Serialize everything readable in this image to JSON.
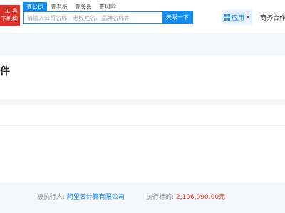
{
  "header": {
    "logo_lines": [
      "工 具",
      "下机构"
    ],
    "tabs": [
      {
        "label": "查公司"
      },
      {
        "label": "查老板"
      },
      {
        "label": "查关系"
      },
      {
        "label": "查风险"
      }
    ],
    "search": {
      "placeholder": "请输入公司名称、老板姓名、品牌名称等",
      "button_label": "天眼一下"
    },
    "apps_label": "应用",
    "cooperation_label": "商务合作"
  },
  "main": {
    "title_fragment": "件"
  },
  "footer": {
    "executed_person_label": "被执行人:",
    "executed_person_value": "阿里云计算有限公司",
    "amount_label": "执行标的:",
    "amount_value": "2,106,090.00元"
  },
  "colors": {
    "brand_blue": "#128bed",
    "logo_red": "#d8322a",
    "amount_red": "#e0322a"
  }
}
